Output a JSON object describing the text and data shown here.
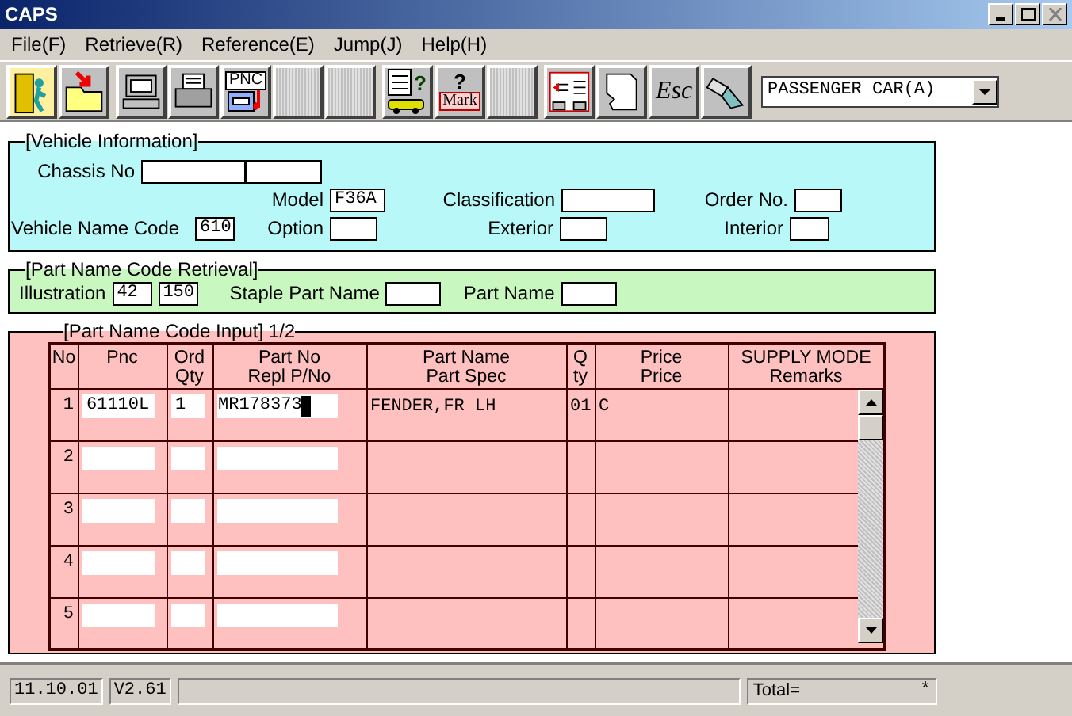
{
  "window": {
    "title": "CAPS"
  },
  "menu": [
    {
      "label": "File(F)"
    },
    {
      "label": "Retrieve(R)"
    },
    {
      "label": "Reference(E)"
    },
    {
      "label": "Jump(J)"
    },
    {
      "label": "Help(H)"
    }
  ],
  "toolbar": [
    [
      {
        "kind": "exit"
      },
      {
        "kind": "folder"
      }
    ],
    [
      {
        "kind": "computer"
      },
      {
        "kind": "printer"
      },
      {
        "kind": "pnc",
        "label": "PNC"
      },
      {
        "kind": "blank"
      },
      {
        "kind": "blank"
      }
    ],
    [
      {
        "kind": "query",
        "label": "?"
      },
      {
        "kind": "mark",
        "label": "?",
        "label2": "Mark"
      },
      {
        "kind": "blank"
      }
    ],
    [
      {
        "kind": "panel"
      },
      {
        "kind": "page"
      },
      {
        "kind": "esc",
        "label": "Esc"
      },
      {
        "kind": "lamp"
      }
    ]
  ],
  "vehicle_type": {
    "value": "PASSENGER CAR(A)"
  },
  "vehicle_information": {
    "title": "[Vehicle Information]",
    "chassis_no_label": "Chassis No",
    "model_label": "Model",
    "model": "F36A",
    "classification_label": "Classification",
    "order_no_label": "Order No.",
    "vehicle_name_code_label": "Vehicle Name Code",
    "vehicle_name_code": "610",
    "option_label": "Option",
    "exterior_label": "Exterior",
    "interior_label": "Interior"
  },
  "part_name_code_retrieval": {
    "title": "[Part Name Code Retrieval]",
    "illustration_label": "Illustration",
    "illustration_1": "42",
    "illustration_2": "150",
    "staple_part_name_label": "Staple Part Name",
    "part_name_label": "Part Name"
  },
  "part_name_code_input": {
    "title": "[Part Name Code Input] 1/2",
    "columns": [
      {
        "lines": [
          "No"
        ]
      },
      {
        "lines": [
          "Pnc"
        ]
      },
      {
        "lines": [
          "Ord",
          "Qty"
        ]
      },
      {
        "lines": [
          "Part No",
          "Repl P/No"
        ]
      },
      {
        "lines": [
          "Part Name",
          "Part Spec"
        ]
      },
      {
        "lines": [
          "Q",
          "ty"
        ]
      },
      {
        "lines": [
          "Price",
          "Price"
        ]
      },
      {
        "lines": [
          "SUPPLY MODE",
          "Remarks"
        ]
      }
    ],
    "rows": [
      {
        "no": "1",
        "pnc": "61110L",
        "ord_qty": "1",
        "part_no": "MR178373",
        "cursor": true,
        "part_name": "FENDER,FR LH",
        "qty": "01",
        "price": "C"
      },
      {
        "no": "2",
        "cursor": false
      },
      {
        "no": "3",
        "cursor": false
      },
      {
        "no": "4",
        "cursor": false
      },
      {
        "no": "5",
        "cursor": false
      }
    ]
  },
  "status_bar": {
    "date": "11.10.01",
    "version": "V2.61",
    "total_label": "Total=",
    "total_value": "*"
  }
}
